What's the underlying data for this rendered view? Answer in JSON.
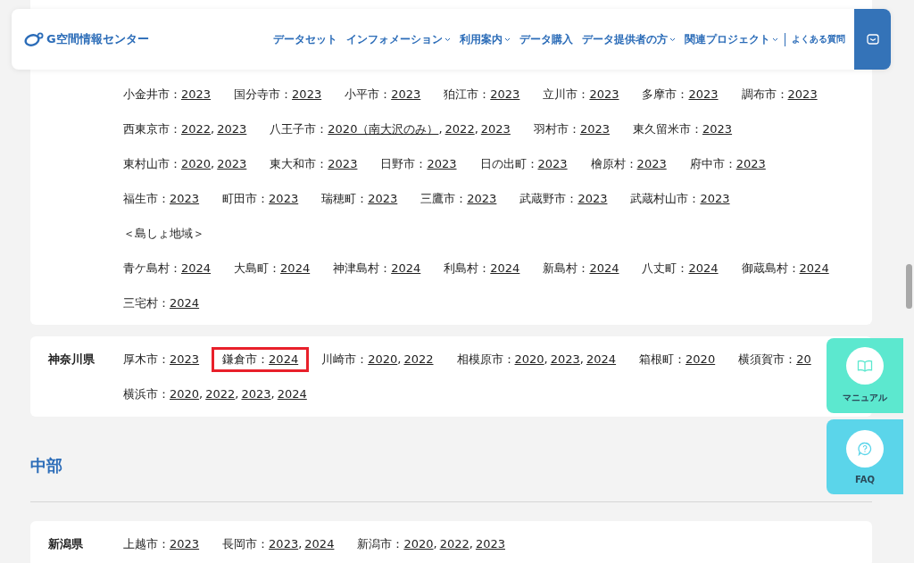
{
  "header": {
    "logo": "G空間情報センター",
    "nav": [
      {
        "label": "データセット",
        "dropdown": false
      },
      {
        "label": "インフォメーション",
        "dropdown": true
      },
      {
        "label": "利用案内",
        "dropdown": true
      },
      {
        "label": "データ購入",
        "dropdown": false
      },
      {
        "label": "データ提供者の方",
        "dropdown": true
      },
      {
        "label": "関連プロジェクト",
        "dropdown": true
      }
    ],
    "faq_link": "よくある質問"
  },
  "sections": [
    {
      "kind": "card",
      "items": [
        {
          "kind": "city",
          "name": "小金井市：",
          "years": [
            "2023"
          ],
          "highlighted": false
        },
        {
          "kind": "city",
          "name": "国分寺市：",
          "years": [
            "2023"
          ],
          "highlighted": false
        },
        {
          "kind": "city",
          "name": "小平市：",
          "years": [
            "2023"
          ],
          "highlighted": false
        },
        {
          "kind": "city",
          "name": "狛江市：",
          "years": [
            "2023"
          ],
          "highlighted": false
        },
        {
          "kind": "city",
          "name": "立川市：",
          "years": [
            "2023"
          ],
          "highlighted": false
        },
        {
          "kind": "city",
          "name": "多摩市：",
          "years": [
            "2023"
          ],
          "highlighted": false
        },
        {
          "kind": "city",
          "name": "調布市：",
          "years": [
            "2023"
          ],
          "highlighted": false
        },
        {
          "kind": "break"
        },
        {
          "kind": "city",
          "name": "西東京市：",
          "years": [
            "2022",
            "2023"
          ],
          "separators": [
            ","
          ],
          "highlighted": false
        },
        {
          "kind": "city",
          "name": "八王子市：",
          "years": [
            "2020（南大沢のみ）",
            "2022",
            "2023"
          ],
          "separators": [
            ",",
            ","
          ],
          "highlighted": false
        },
        {
          "kind": "city",
          "name": "羽村市：",
          "years": [
            "2023"
          ],
          "highlighted": false
        },
        {
          "kind": "city",
          "name": "東久留米市：",
          "years": [
            "2023"
          ],
          "highlighted": false
        },
        {
          "kind": "break"
        },
        {
          "kind": "city",
          "name": "東村山市：",
          "years": [
            "2020",
            "2023"
          ],
          "separators": [
            ","
          ],
          "highlighted": false
        },
        {
          "kind": "city",
          "name": "東大和市：",
          "years": [
            "2023"
          ],
          "highlighted": false
        },
        {
          "kind": "city",
          "name": "日野市：",
          "years": [
            "2023"
          ],
          "highlighted": false
        },
        {
          "kind": "city",
          "name": "日の出町：",
          "years": [
            "2023"
          ],
          "highlighted": false
        },
        {
          "kind": "city",
          "name": "檜原村：",
          "years": [
            "2023"
          ],
          "highlighted": false
        },
        {
          "kind": "city",
          "name": "府中市：",
          "years": [
            "2023"
          ],
          "highlighted": false
        },
        {
          "kind": "break"
        },
        {
          "kind": "city",
          "name": "福生市：",
          "years": [
            "2023"
          ],
          "highlighted": false
        },
        {
          "kind": "city",
          "name": "町田市：",
          "years": [
            "2023"
          ],
          "highlighted": false
        },
        {
          "kind": "city",
          "name": "瑞穂町：",
          "years": [
            "2023"
          ],
          "highlighted": false
        },
        {
          "kind": "city",
          "name": "三鷹市：",
          "years": [
            "2023"
          ],
          "highlighted": false
        },
        {
          "kind": "city",
          "name": "武蔵野市：",
          "years": [
            "2023"
          ],
          "highlighted": false
        },
        {
          "kind": "city",
          "name": "武蔵村山市：",
          "years": [
            "2023"
          ],
          "highlighted": false
        },
        {
          "kind": "heading",
          "text": "＜島しょ地域＞"
        },
        {
          "kind": "city",
          "name": "青ケ島村：",
          "years": [
            "2024"
          ],
          "highlighted": false
        },
        {
          "kind": "city",
          "name": "大島町：",
          "years": [
            "2024"
          ],
          "highlighted": false
        },
        {
          "kind": "city",
          "name": "神津島村：",
          "years": [
            "2024"
          ],
          "highlighted": false
        },
        {
          "kind": "city",
          "name": "利島村：",
          "years": [
            "2024"
          ],
          "highlighted": false
        },
        {
          "kind": "city",
          "name": "新島村：",
          "years": [
            "2024"
          ],
          "highlighted": false
        },
        {
          "kind": "city",
          "name": "八丈町：",
          "years": [
            "2024"
          ],
          "highlighted": false
        },
        {
          "kind": "city",
          "name": "御蔵島村：",
          "years": [
            "2024"
          ],
          "highlighted": false
        },
        {
          "kind": "break"
        },
        {
          "kind": "city",
          "name": "三宅村：",
          "years": [
            "2024"
          ],
          "highlighted": false
        }
      ]
    },
    {
      "kind": "card",
      "prefecture": "神奈川県",
      "items": [
        {
          "kind": "city",
          "name": "厚木市：",
          "years": [
            "2023"
          ],
          "highlighted": false
        },
        {
          "kind": "city",
          "name": "鎌倉市：",
          "years": [
            "2024"
          ],
          "highlighted": true
        },
        {
          "kind": "city",
          "name": "川崎市：",
          "years": [
            "2020",
            "2022"
          ],
          "separators": [
            ","
          ],
          "highlighted": false
        },
        {
          "kind": "city",
          "name": "相模原市：",
          "years": [
            "2020",
            "2023",
            "2024"
          ],
          "separators": [
            ",",
            ","
          ],
          "highlighted": false
        },
        {
          "kind": "city",
          "name": "箱根町：",
          "years": [
            "2020"
          ],
          "highlighted": false
        },
        {
          "kind": "city",
          "name": "横須賀市：",
          "years": [
            "20"
          ],
          "highlighted": false
        },
        {
          "kind": "break"
        },
        {
          "kind": "city",
          "name": "横浜市：",
          "years": [
            "2020",
            "2022",
            "2023",
            "2024"
          ],
          "separators": [
            ",",
            ",",
            ","
          ],
          "highlighted": false
        }
      ]
    },
    {
      "kind": "region",
      "title": "中部"
    },
    {
      "kind": "card",
      "prefecture": "新潟県",
      "items": [
        {
          "kind": "city",
          "name": "上越市：",
          "years": [
            "2023"
          ],
          "highlighted": false
        },
        {
          "kind": "city",
          "name": "長岡市：",
          "years": [
            "2023",
            "2024"
          ],
          "separators": [
            ","
          ],
          "highlighted": false
        },
        {
          "kind": "city",
          "name": "新潟市：",
          "years": [
            "2020",
            "2022",
            "2023"
          ],
          "separators": [
            ",",
            ","
          ],
          "highlighted": false
        }
      ]
    }
  ],
  "side_buttons": [
    {
      "kind": "manual",
      "label": "マニュアル"
    },
    {
      "kind": "faq",
      "label": "FAQ"
    }
  ]
}
